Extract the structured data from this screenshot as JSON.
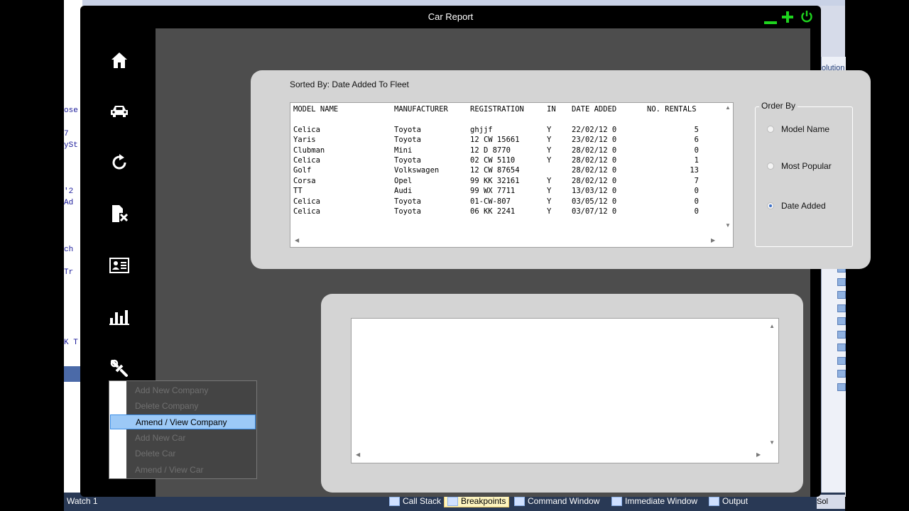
{
  "window": {
    "title": "Car Report"
  },
  "ide": {
    "left_fragments": [
      "ose",
      "7",
      "ySt",
      "'2",
      "Ad",
      "ch",
      "Tr",
      "K T"
    ],
    "right_label": "olution",
    "status_items": [
      {
        "label": "Watch 1",
        "icon": "watch-icon"
      },
      {
        "label": "Call Stack",
        "icon": "call-stack-icon"
      },
      {
        "label": "Breakpoints",
        "icon": "breakpoints-icon",
        "active": true
      },
      {
        "label": "Command Window",
        "icon": "command-window-icon"
      },
      {
        "label": "Immediate Window",
        "icon": "immediate-window-icon"
      },
      {
        "label": "Output",
        "icon": "output-icon"
      }
    ],
    "sol_tab": "Sol"
  },
  "sidebar": {
    "icons": [
      "home-icon",
      "car-icon",
      "refresh-icon",
      "delete-file-icon",
      "contact-card-icon",
      "bar-chart-icon",
      "wrench-icon"
    ]
  },
  "report": {
    "sorted_by": "Sorted By: Date Added To Fleet",
    "columns": [
      "MODEL NAME",
      "MANUFACTURER",
      "REGISTRATION",
      "IN",
      "DATE ADDED",
      "NO. RENTALS"
    ],
    "rows": [
      [
        "Celica",
        "Toyota",
        "ghjjf",
        "Y",
        "22/02/12 0",
        "5"
      ],
      [
        "Yaris",
        "Toyota",
        "12 CW 15661",
        "Y",
        "23/02/12 0",
        "6"
      ],
      [
        "Clubman",
        "Mini",
        "12 D 8770",
        "Y",
        "28/02/12 0",
        "0"
      ],
      [
        "Celica",
        "Toyota",
        "02 CW 5110",
        "Y",
        "28/02/12 0",
        "1"
      ],
      [
        "Golf",
        "Volkswagen",
        "12 CW 87654",
        "",
        "28/02/12 0",
        "13"
      ],
      [
        "Corsa",
        "Opel",
        "99 KK 32161",
        "Y",
        "28/02/12 0",
        "7"
      ],
      [
        "TT",
        "Audi",
        "99 WX 7711",
        "Y",
        "13/03/12 0",
        "0"
      ],
      [
        "Celica",
        "Toyota",
        "01-CW-807",
        "Y",
        "03/05/12 0",
        "0"
      ],
      [
        "Celica",
        "Toyota",
        "06 KK 2241",
        "Y",
        "03/07/12 0",
        "0"
      ]
    ]
  },
  "order_by": {
    "legend": "Order By",
    "options": [
      {
        "label": "Model Name",
        "checked": false
      },
      {
        "label": "Most Popular",
        "checked": false
      },
      {
        "label": "Date Added",
        "checked": true
      }
    ]
  },
  "context_menu": {
    "items": [
      {
        "label": "Add New Company",
        "enabled": false
      },
      {
        "label": "Delete Company",
        "enabled": false
      },
      {
        "label": "Amend / View Company",
        "selected": true
      },
      {
        "label": "Add New Car",
        "enabled": false
      },
      {
        "label": "Delete Car",
        "enabled": false
      },
      {
        "label": "Amend / View Car",
        "enabled": false
      }
    ]
  },
  "colors": {
    "accent_green": "#1ed41e",
    "panel": "#d4d4d4",
    "background": "#4d4d4d",
    "selection": "#9cc9f7"
  }
}
